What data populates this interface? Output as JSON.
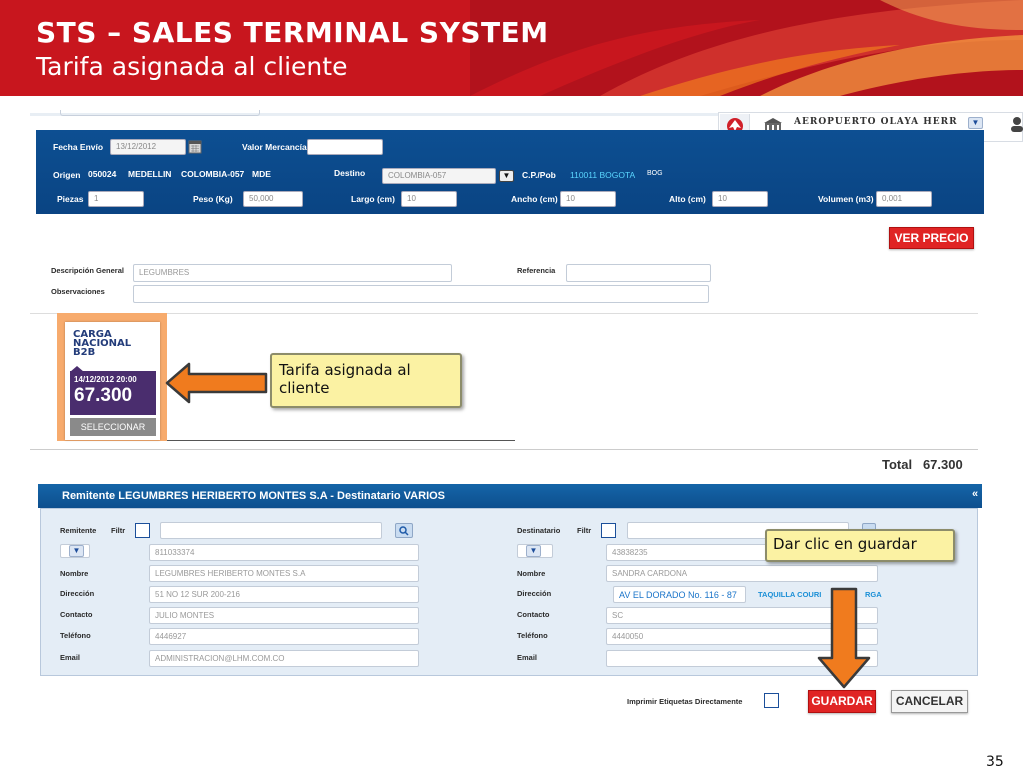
{
  "slide": {
    "title": "STS – SALES  TERMINAL SYSTEM",
    "subtitle": "Tarifa asignada al cliente",
    "page_number": "35"
  },
  "airport": {
    "name": "AEROPUERTO OLAYA HERR"
  },
  "shipment": {
    "fecha_envio_label": "Fecha Envío",
    "fecha_envio_value": "13/12/2012",
    "valor_mercancia_label": "Valor Mercancía",
    "valor_mercancia_value": "",
    "origen_label": "Origen",
    "origen_code": "050024",
    "origen_city": "MEDELLIN",
    "origen_country": "COLOMBIA-057",
    "origen_abbr": "MDE",
    "destino_label": "Destino",
    "destino_value": "COLOMBIA-057",
    "cp_label": "C.P./Pob",
    "cp_value": "110011 BOGOTA",
    "cp_abbr": "BOG",
    "piezas_label": "Piezas",
    "piezas_value": "1",
    "peso_label": "Peso (Kg)",
    "peso_value": "50,000",
    "largo_label": "Largo (cm)",
    "largo_value": "10",
    "ancho_label": "Ancho (cm)",
    "ancho_value": "10",
    "alto_label": "Alto (cm)",
    "alto_value": "10",
    "volumen_label": "Volumen (m3)",
    "volumen_value": "0,001"
  },
  "ver_precio_label": "VER PRECIO",
  "details": {
    "descripcion_label": "Descripción General",
    "descripcion_value": "LEGUMBRES",
    "referencia_label": "Referencia",
    "referencia_value": "",
    "observaciones_label": "Observaciones",
    "observaciones_value": ""
  },
  "tariff_card": {
    "title": "CARGA NACIONAL B2B",
    "date": "14/12/2012 20:00",
    "price": "67.300",
    "select_label": "SELECCIONAR"
  },
  "callouts": {
    "tarifa": "Tarifa asignada al cliente",
    "guardar": "Dar clic en guardar"
  },
  "total": {
    "label": "Total",
    "value": "67.300"
  },
  "parties": {
    "header": "Remitente LEGUMBRES HERIBERTO MONTES S.A - Destinatario VARIOS",
    "collapse_glyph": "«",
    "remitente_label": "Remitente",
    "destinatario_label": "Destinatario",
    "filtrar_label": "Filtr",
    "nombre_label": "Nombre",
    "direccion_label": "Dirección",
    "contacto_label": "Contacto",
    "telefono_label": "Teléfono",
    "email_label": "Email",
    "remitente": {
      "id": "811033374",
      "nombre": "LEGUMBRES HERIBERTO MONTES S.A",
      "direccion": "51 NO 12 SUR 200-216",
      "contacto": "JULIO MONTES",
      "telefono": "4446927",
      "email": "ADMINISTRACION@LHM.COM.CO"
    },
    "destinatario": {
      "id": "43838235",
      "nombre": "SANDRA CARDONA",
      "direccion": "AV EL DORADO No. 116 - 87",
      "direccion_extra": "TAQUILLA COURI",
      "direccion_extra_tail": "RGA",
      "contacto": "SC",
      "telefono": "4440050",
      "email": ""
    }
  },
  "footer": {
    "imprimir_label": "Imprimir Etiquetas Directamente",
    "guardar_label": "GUARDAR",
    "cancelar_label": "CANCELAR"
  },
  "colors": {
    "header_red": "#c8161e",
    "form_blue": "#0d4f92",
    "button_red": "#e02424",
    "callout_fill": "#fbf2a3",
    "arrow_orange": "#f07b1e",
    "card_orange": "#f7ab6d",
    "card_purple": "#4a2d6e"
  }
}
